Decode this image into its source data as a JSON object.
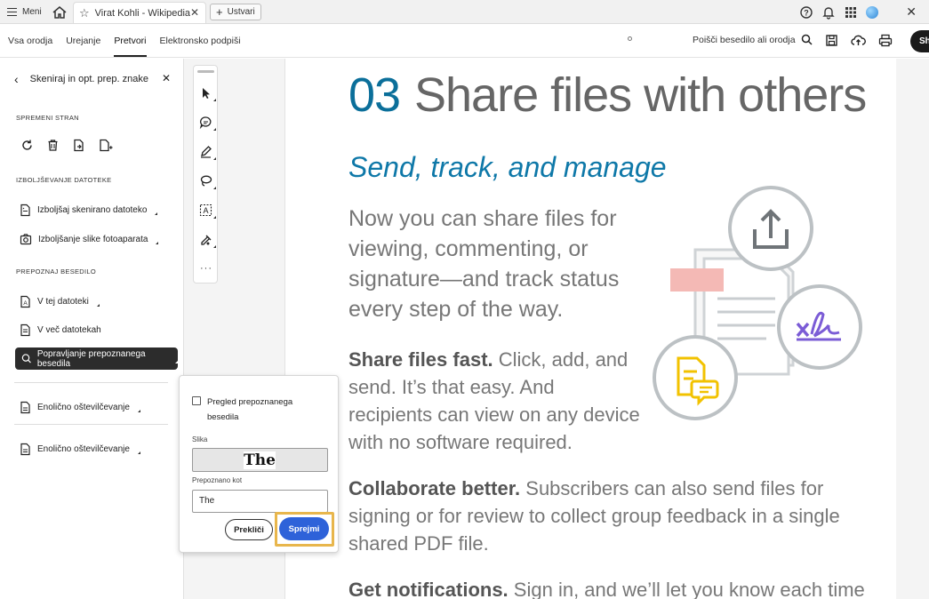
{
  "browser": {
    "menu_label": "Meni",
    "tab_title": "Virat Kohli - Wikipedia",
    "new_tab_label": "Ustvari"
  },
  "toolbar": {
    "menus": [
      "Vsa orodja",
      "Urejanje",
      "Pretvori",
      "Elektronsko podpiši"
    ],
    "search_label": "Poišči besedilo ali orodja",
    "share_label": "Sh"
  },
  "panel": {
    "title": "Skeniraj in opt. prep. znake",
    "section_page": "SPREMENI STRAN",
    "section_improve": "IZBOLJŠEVANJE DATOTEKE",
    "improve_scanned": "Izboljšaj skenirano datoteko",
    "improve_camera": "Izboljšanje slike fotoaparata",
    "section_recognize": "PREPOZNAJ BESEDILO",
    "in_file": "V tej datoteki",
    "in_files": "V več datotekah",
    "correct_text": "Popravljanje prepoznanega besedila",
    "stamp1": "Enolično oštevilčevanje",
    "stamp2": "Enolično oštevilčevanje"
  },
  "popup": {
    "review_label": "Pregled prepoznanega besedila",
    "image_label": "Slika",
    "ocr_image_text": "The",
    "recognized_label": "Prepoznano kot",
    "recognized_value": "The",
    "cancel_label": "Prekliči",
    "accept_label": "Sprejmi"
  },
  "document": {
    "heading_number": "03",
    "heading_title": "Share files with others",
    "subheading": "Send, track, and manage",
    "intro": "Now you can share files for viewing, commenting, or signature—and track status every step of the way.",
    "p1_bold": "Share files fast.",
    "p1_text": " Click, add, and send. It’s that easy. And recipients can view on any device with no software required.",
    "p2_bold": "Collaborate better.",
    "p2_text": " Subscribers can also send files for signing or for review to collect group feedback in a single shared PDF file.",
    "p3_bold": "Get notifications.",
    "p3_text": " Sign in, and we’ll let you know each time"
  },
  "colors": {
    "accent_blue": "#0b6f9a",
    "button_blue": "#2e62d9",
    "highlight": "#e8b64c",
    "signature_purple": "#7b5cd6",
    "doc_yellow": "#f2c200",
    "pink_tab": "#f4b9b5"
  }
}
